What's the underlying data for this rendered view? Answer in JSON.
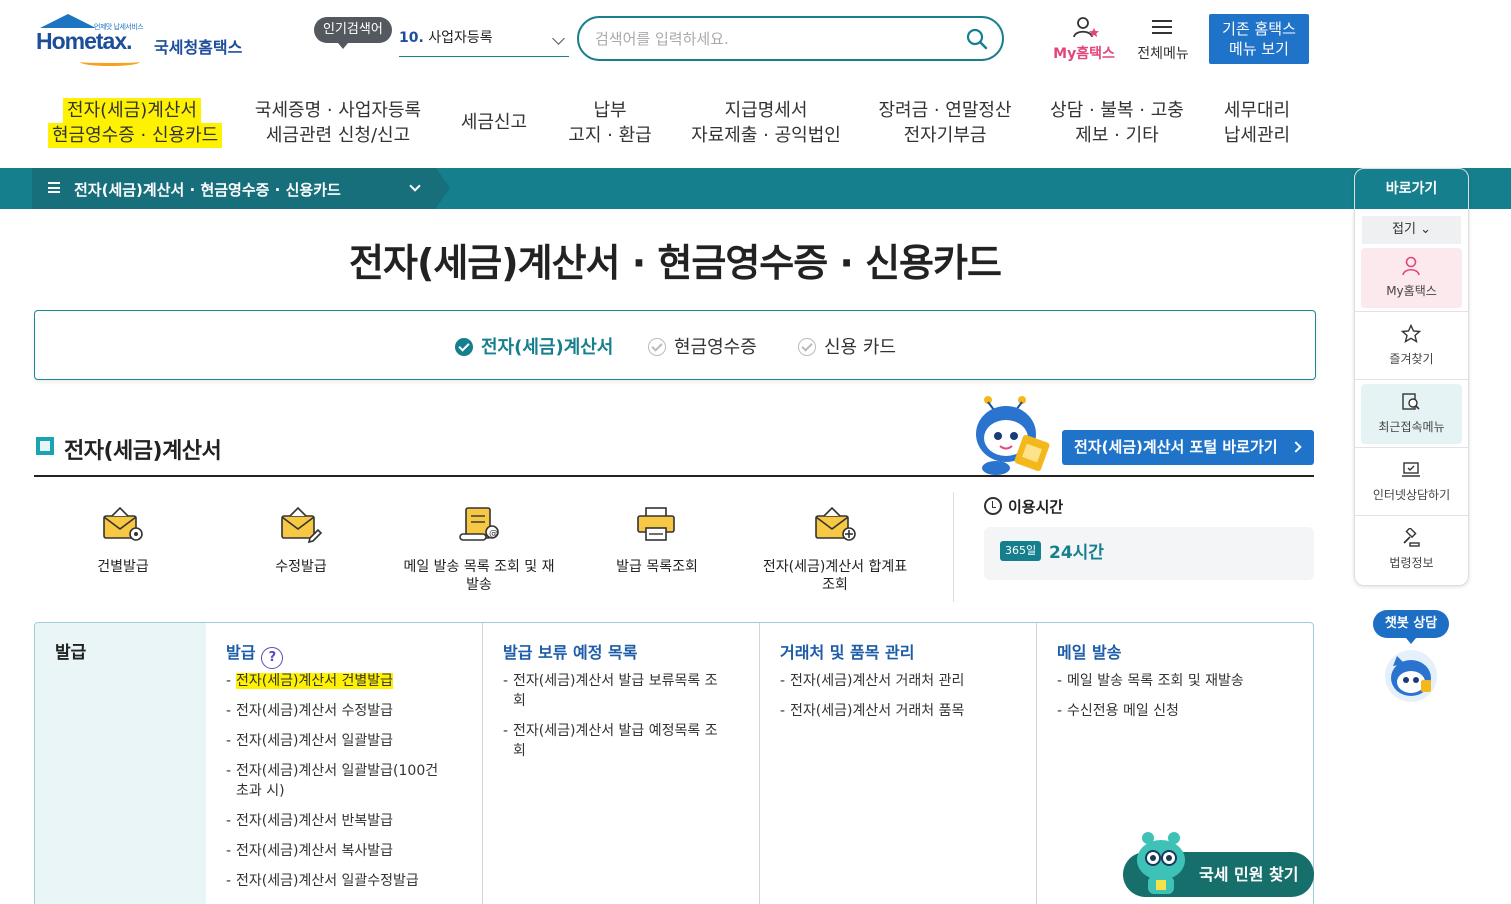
{
  "header": {
    "logo_tagline": "언제맛 납세서비스",
    "logo_text": "Hometax.",
    "logo_kr": "국세청홈택스",
    "popular_label": "인기검색어",
    "popular_rank": "10.",
    "popular_keyword": "사업자등록",
    "search_placeholder": "검색어를 입력하세요.",
    "my_hometax": "My홈택스",
    "all_menu": "전체메뉴",
    "old_menu_line1": "기존 홈택스",
    "old_menu_line2": "메뉴 보기"
  },
  "gnb": [
    {
      "line1": "전자(세금)계산서",
      "line2": "현금영수증 · 신용카드",
      "highlighted": true
    },
    {
      "line1": "국세증명 · 사업자등록",
      "line2": "세금관련 신청/신고"
    },
    {
      "line1": "세금신고",
      "line2": ""
    },
    {
      "line1": "납부",
      "line2": "고지 · 환급"
    },
    {
      "line1": "지급명세서",
      "line2": "자료제출 · 공익법인"
    },
    {
      "line1": "장려금 · 연말정산",
      "line2": "전자기부금"
    },
    {
      "line1": "상담 · 불복 · 고충",
      "line2": "제보 · 기타"
    },
    {
      "line1": "세무대리",
      "line2": "납세관리"
    }
  ],
  "breadcrumb": "전자(세금)계산서 · 현금영수증 · 신용카드",
  "page_title": "전자(세금)계산서 · 현금영수증 · 신용카드",
  "tabs": [
    {
      "label": "전자(세금)계산서",
      "active": true
    },
    {
      "label": "현금영수증",
      "active": false
    },
    {
      "label": "신용 카드",
      "active": false
    }
  ],
  "section": {
    "title": "전자(세금)계산서",
    "portal_button": "전자(세금)계산서 포털 바로가기"
  },
  "quick_menu": [
    {
      "label": "건별발급",
      "icon": "envelope-gear-icon"
    },
    {
      "label": "수정발급",
      "icon": "envelope-edit-icon"
    },
    {
      "label": "메일 발송 목록 조회 및 재발송",
      "icon": "scroll-mail-icon"
    },
    {
      "label": "발급 목록조회",
      "icon": "printer-icon"
    },
    {
      "label": "전자(세금)계산서 합계표 조회",
      "icon": "envelope-plus-icon"
    }
  ],
  "service_time": {
    "title": "이용시간",
    "badge": "365일",
    "value": "24시간"
  },
  "menu_grid": {
    "side_title": "발급",
    "columns": [
      {
        "head": "발급",
        "help": "?",
        "items": [
          "전자(세금)계산서 건별발급",
          "전자(세금)계산서 수정발급",
          "전자(세금)계산서 일괄발급",
          "전자(세금)계산서 일괄발급(100건 초과 시)",
          "전자(세금)계산서 반복발급",
          "전자(세금)계산서 복사발급",
          "전자(세금)계산서 일괄수정발급"
        ]
      },
      {
        "head": "발급 보류 예정 목록",
        "items": [
          "전자(세금)계산서 발급 보류목록 조회",
          "전자(세금)계산서 발급 예정목록 조회"
        ]
      },
      {
        "head": "거래처 및 품목 관리",
        "items": [
          "전자(세금)계산서 거래처 관리",
          "전자(세금)계산서 거래처 품목"
        ]
      },
      {
        "head": "메일 발송",
        "items": [
          "메일 발송 목록 조회 및 재발송",
          "수신전용 메일 신청"
        ]
      }
    ]
  },
  "quick_panel": {
    "title": "바로가기",
    "fold": "접기",
    "items": [
      {
        "label": "My홈택스",
        "icon": "person-icon"
      },
      {
        "label": "즐겨찾기",
        "icon": "star-icon"
      },
      {
        "label": "최근접속메뉴",
        "icon": "recent-search-icon"
      },
      {
        "label": "인터넷상담하기",
        "icon": "laptop-chat-icon"
      },
      {
        "label": "법령정보",
        "icon": "gavel-icon"
      }
    ]
  },
  "chatbot_label": "챗봇 상담",
  "civil_button": "국세 민원 찾기",
  "colors": {
    "teal": "#157f8e",
    "blue": "#1f73c8",
    "highlight": "#fff200",
    "pink": "#e3477a"
  }
}
